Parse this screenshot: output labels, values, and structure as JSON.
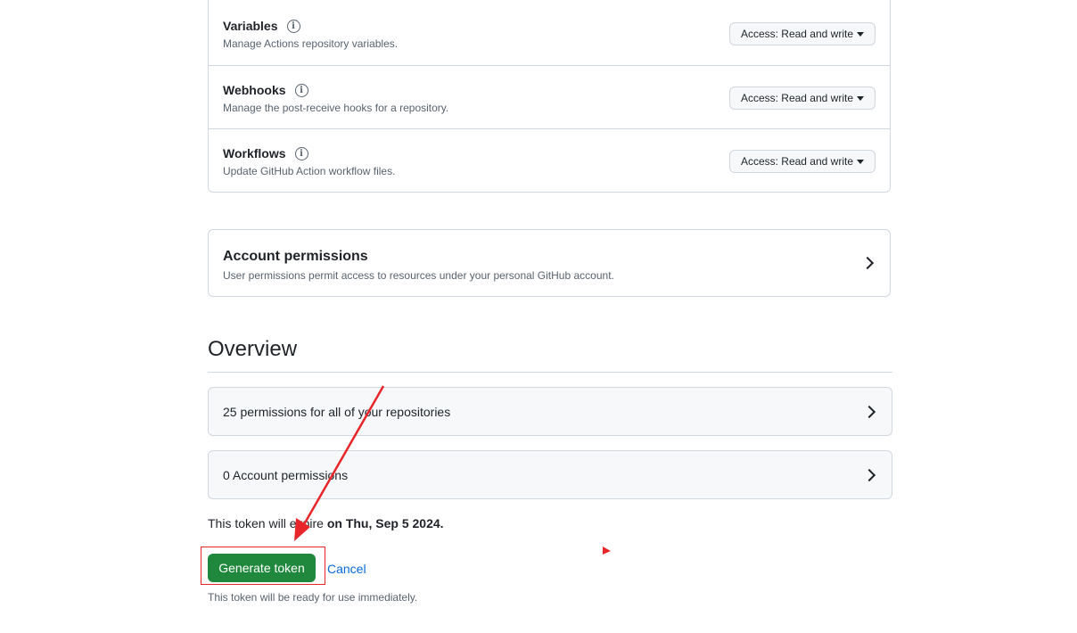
{
  "repo_permissions": [
    {
      "title": "Variables",
      "desc": "Manage Actions repository variables.",
      "access": "Access: Read and write"
    },
    {
      "title": "Webhooks",
      "desc": "Manage the post-receive hooks for a repository.",
      "access": "Access: Read and write"
    },
    {
      "title": "Workflows",
      "desc": "Update GitHub Action workflow files.",
      "access": "Access: Read and write"
    }
  ],
  "account_permissions": {
    "title": "Account permissions",
    "desc": "User permissions permit access to resources under your personal GitHub account."
  },
  "overview": {
    "heading": "Overview",
    "repo_summary": "25 permissions for all of your repositories",
    "account_summary": "0 Account permissions"
  },
  "expiry": {
    "prefix": "This token will expire ",
    "date": "on Thu, Sep 5 2024."
  },
  "actions": {
    "generate_label": "Generate token",
    "cancel_label": "Cancel",
    "note": "This token will be ready for use immediately."
  },
  "colors": {
    "primary_button": "#1f883d",
    "link": "#0969da",
    "annotation": "#e8262a"
  },
  "icons": {
    "info": "info-icon",
    "chevron": "chevron-right-icon",
    "caret": "caret-down-icon"
  }
}
